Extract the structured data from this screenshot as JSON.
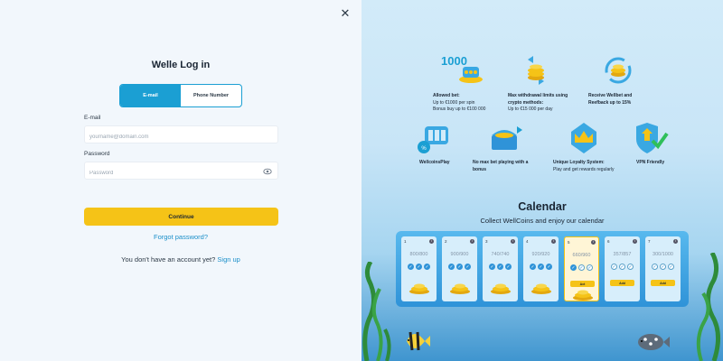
{
  "login": {
    "title": "Welle Log in",
    "tabs": [
      "E-mail",
      "Phone Number"
    ],
    "email_label": "E-mail",
    "email_placeholder": "yourname@domain.com",
    "password_label": "Password",
    "password_placeholder": "Password",
    "continue": "Continue",
    "forgot": "Forgot password?",
    "no_account": "You don't have an account yet?",
    "signup": "Sign up"
  },
  "promo": {
    "big_number": "1000",
    "features": [
      {
        "title": "Allowed bet:",
        "lines": [
          "Up to €1000 per spin",
          "Bonus buy up to €100 000"
        ]
      },
      {
        "title": "Max withdrawal limits using crypto methods:",
        "lines": [
          "Up to €15 000 per day"
        ]
      },
      {
        "title": "Receive Wellbet and Reefback up to 15%",
        "lines": []
      },
      {
        "title": "WellcoinsPlay",
        "lines": []
      },
      {
        "title": "No max bet playing with a bonus",
        "lines": []
      },
      {
        "title": "Unique Loyalty System:",
        "lines": [
          "Play and get rewards regularly"
        ]
      },
      {
        "title": "VPN Friendly",
        "lines": []
      }
    ],
    "calendar_title": "Calendar",
    "calendar_subtitle": "Collect WellCoins and enjoy our calendar",
    "days": [
      {
        "n": "1",
        "progress": "800/800",
        "checks": [
          true,
          true,
          true
        ]
      },
      {
        "n": "2",
        "progress": "900/900",
        "checks": [
          true,
          true,
          true
        ]
      },
      {
        "n": "3",
        "progress": "740/740",
        "checks": [
          true,
          true,
          true
        ]
      },
      {
        "n": "4",
        "progress": "920/920",
        "checks": [
          true,
          true,
          true
        ]
      },
      {
        "n": "5",
        "progress": "660/960",
        "checks": [
          true,
          false,
          false
        ],
        "action": "Act"
      },
      {
        "n": "6",
        "progress": "357/857",
        "checks": [
          false,
          false,
          false
        ],
        "action": "Add"
      },
      {
        "n": "7",
        "progress": "300/1000",
        "checks": [
          false,
          false,
          false
        ],
        "action": "Add"
      }
    ]
  },
  "colors": {
    "accent": "#1b9fd3",
    "yellow": "#f5c317",
    "link": "#1b8fc9"
  }
}
